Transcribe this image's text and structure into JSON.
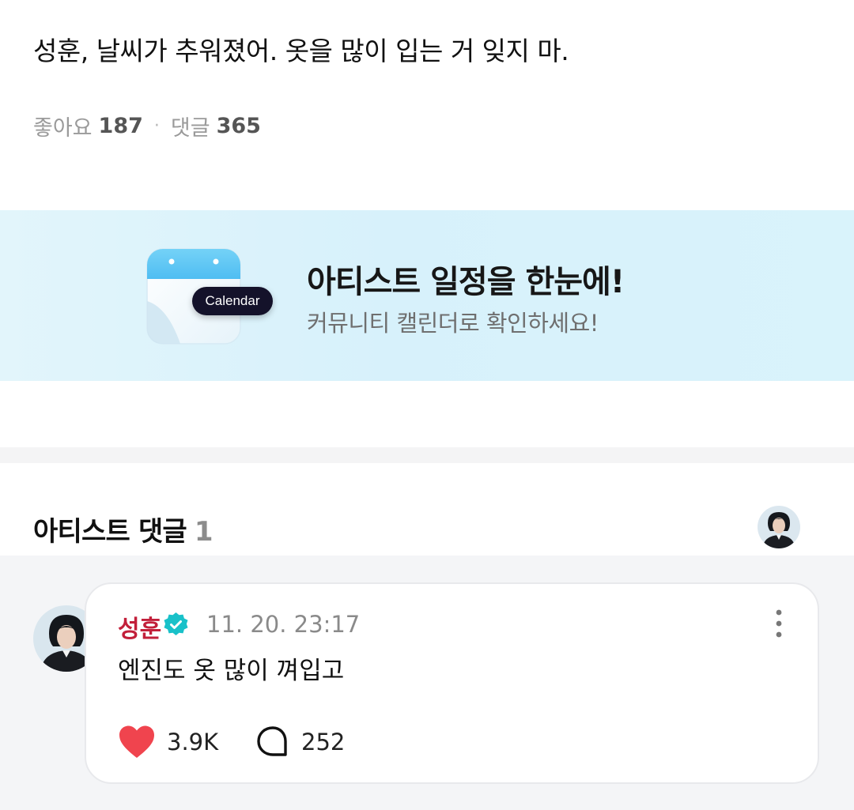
{
  "post": {
    "text": "성훈, 날씨가 추워졌어. 옷을 많이 입는 거 잊지 마.",
    "likes_label": "좋아요",
    "likes_count": "187",
    "separator": "·",
    "comments_label": "댓글",
    "comments_count": "365"
  },
  "banner": {
    "title": "아티스트 일정을 한눈에!",
    "subtitle": "커뮤니티 캘린더로 확인하세요!",
    "pill": "Calendar",
    "icon": "calendar-icon"
  },
  "artist_comments": {
    "title": "아티스트 댓글",
    "count": "1",
    "comments": [
      {
        "author": "성훈",
        "verified_icon": "verified-badge-icon",
        "timestamp": "11. 20. 23:17",
        "body": "엔진도 옷 많이 껴입고",
        "likes": "3.9K",
        "replies": "252"
      }
    ]
  },
  "colors": {
    "author_red": "#c21f3a",
    "verified_teal": "#19c1c9",
    "heart_red": "#f0444e",
    "banner_bg": "#dcf3fb",
    "comments_bg": "#f4f5f7"
  }
}
